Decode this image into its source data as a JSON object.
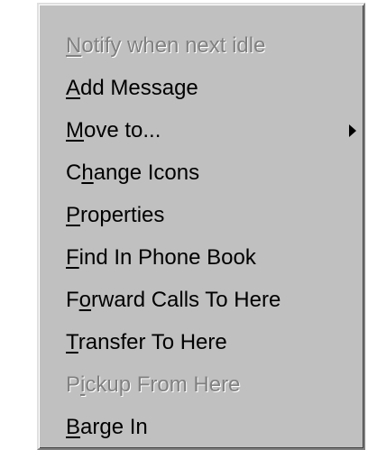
{
  "menu": {
    "items": [
      {
        "pre": "",
        "mnemonic": "N",
        "post": "otify when next idle",
        "disabled": true
      },
      {
        "pre": "",
        "mnemonic": "A",
        "post": "dd Message",
        "disabled": false
      },
      {
        "pre": "",
        "mnemonic": "M",
        "post": "ove to...",
        "disabled": false,
        "submenu_icon": "submenu-arrow-icon"
      },
      {
        "pre": "C",
        "mnemonic": "h",
        "post": "ange Icons",
        "disabled": false
      },
      {
        "pre": "",
        "mnemonic": "P",
        "post": "roperties",
        "disabled": false
      },
      {
        "pre": "",
        "mnemonic": "F",
        "post": "ind In Phone Book",
        "disabled": false
      },
      {
        "pre": "F",
        "mnemonic": "o",
        "post": "rward Calls To Here",
        "disabled": false
      },
      {
        "pre": "",
        "mnemonic": "T",
        "post": "ransfer To Here",
        "disabled": false
      },
      {
        "pre": "P",
        "mnemonic": "i",
        "post": "ckup From Here",
        "disabled": true
      },
      {
        "pre": "",
        "mnemonic": "B",
        "post": "arge In",
        "disabled": false
      }
    ],
    "colors": {
      "background": "#c0c0c0",
      "text": "#000000",
      "disabled_text": "#808080"
    }
  }
}
